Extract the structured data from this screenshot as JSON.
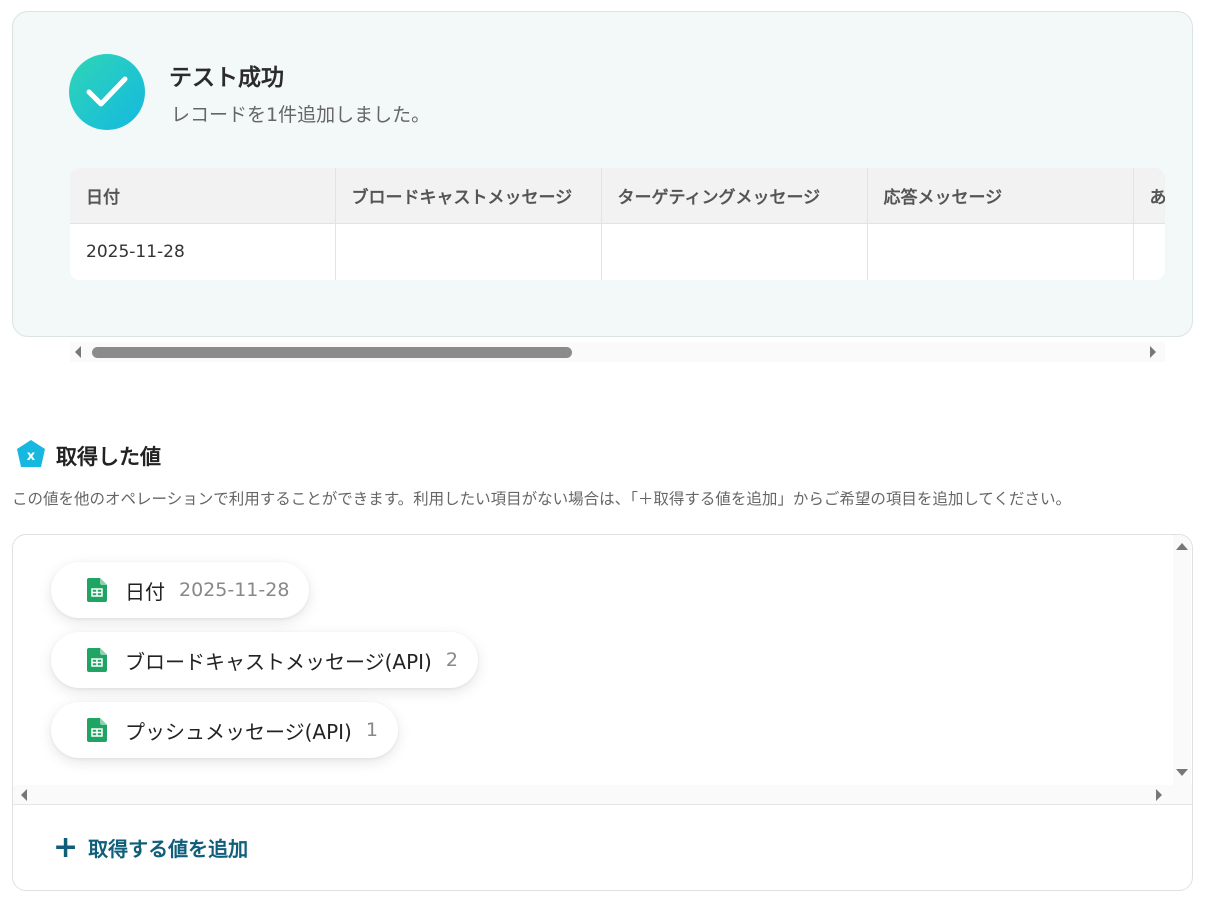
{
  "success": {
    "title": "テスト成功",
    "subtitle": "レコードを1件追加しました。"
  },
  "result_table": {
    "columns": [
      "日付",
      "ブロードキャストメッセージ",
      "ターゲティングメッセージ",
      "応答メッセージ",
      "あ"
    ],
    "rows": [
      [
        "2025-11-28",
        "",
        "",
        "",
        ""
      ]
    ]
  },
  "acquired": {
    "title": "取得した値",
    "description": "この値を他のオペレーションで利用することができます。利用したい項目がない場合は、「＋取得する値を追加」からご希望の項目を追加してください。",
    "items": [
      {
        "label": "日付",
        "value": "2025-11-28"
      },
      {
        "label": "ブロードキャストメッセージ(API)",
        "value": "2"
      },
      {
        "label": "プッシュメッセージ(API)",
        "value": "1"
      }
    ],
    "add_label": "取得する値を追加",
    "add_icon": "+"
  },
  "colors": {
    "accent": "#0f5f7a",
    "success_gradient_start": "#2fd6b6",
    "success_gradient_end": "#14b8e0",
    "sheet_green": "#1fa463",
    "section_icon": "#17b8e0"
  }
}
